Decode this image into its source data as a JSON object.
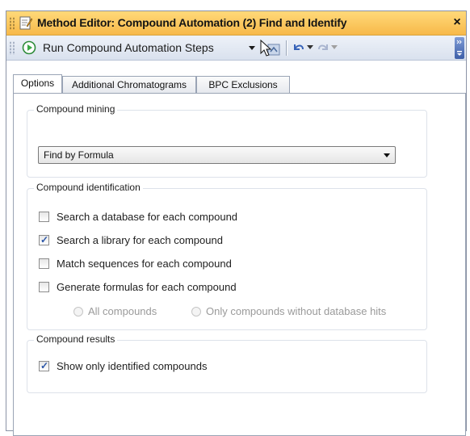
{
  "window": {
    "title": "Method Editor: Compound Automation (2) Find and Identify",
    "close_glyph": "×",
    "title_icon": "document-edit-icon"
  },
  "toolbar": {
    "run_label": "Run Compound Automation Steps",
    "run_icon": "play-circle-icon",
    "icons": [
      "dropdown-arrow-icon",
      "cursor-pointer-icon",
      "undo-icon",
      "redo-icon",
      "toolbar-overflow-icon"
    ]
  },
  "tabs": [
    {
      "label": "Options",
      "active": true
    },
    {
      "label": "Additional Chromatograms",
      "active": false
    },
    {
      "label": "BPC Exclusions",
      "active": false
    }
  ],
  "compound_mining": {
    "title": "Compound mining",
    "selected": "Find by Formula"
  },
  "compound_identification": {
    "title": "Compound identification",
    "options": [
      {
        "label": "Search a database for each compound",
        "checked": false
      },
      {
        "label": "Search a library for each compound",
        "checked": true
      },
      {
        "label": "Match sequences for each compound",
        "checked": false
      },
      {
        "label": "Generate formulas for each compound",
        "checked": false
      }
    ],
    "radios": [
      {
        "label": "All compounds",
        "selected": false,
        "enabled": false
      },
      {
        "label": "Only compounds without database hits",
        "selected": false,
        "enabled": false
      }
    ]
  },
  "compound_results": {
    "title": "Compound results",
    "options": [
      {
        "label": "Show only identified compounds",
        "checked": true
      }
    ]
  },
  "colors": {
    "title_bar": "#f7c15a",
    "toolbar": "#e3e9f3",
    "check_mark": "#2b56a8",
    "run_icon": "#3aa845"
  }
}
